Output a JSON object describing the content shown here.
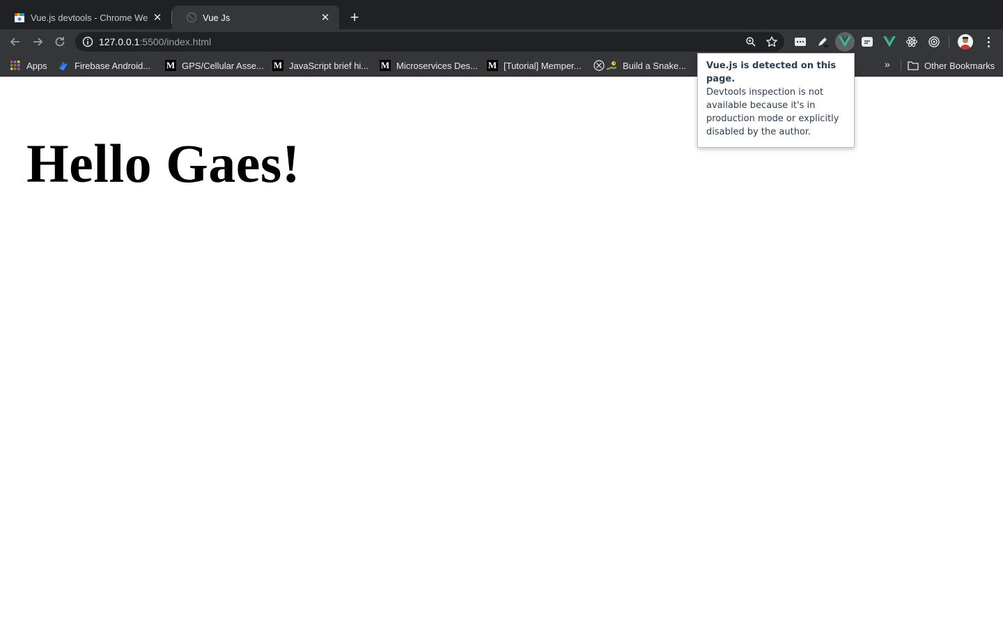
{
  "tabs": [
    {
      "title": "Vue.js devtools - Chrome Web Store",
      "active": false,
      "favicon": "chrome-web-store-icon"
    },
    {
      "title": "Vue Js",
      "active": true,
      "favicon": "globe-icon"
    }
  ],
  "toolbar": {
    "url_host": "127.0.0.1",
    "url_rest": ":5500/index.html"
  },
  "bookmarks": {
    "items": [
      {
        "label": "Apps",
        "icon": "apps-grid-icon"
      },
      {
        "label": "Firebase Android...",
        "icon": "firebase-icon"
      },
      {
        "label": "GPS/Cellular Asse...",
        "icon": "medium-icon"
      },
      {
        "label": "JavaScript brief hi...",
        "icon": "medium-icon"
      },
      {
        "label": "Microservices Des...",
        "icon": "medium-icon"
      },
      {
        "label": "[Tutorial] Memper...",
        "icon": "medium-icon"
      },
      {
        "label": "Build a Snake...",
        "icon": "snake-icon"
      }
    ],
    "other_label": "Other Bookmarks"
  },
  "page": {
    "heading": "Hello Gaes!"
  },
  "popup": {
    "headline": "Vue.js is detected on this page.",
    "message": "Devtools inspection is not available because it's in production mode or explicitly disabled by the author."
  },
  "colors": {
    "vue_green": "#42b883",
    "tab_bar": "#202124",
    "toolbar": "#35363a"
  }
}
